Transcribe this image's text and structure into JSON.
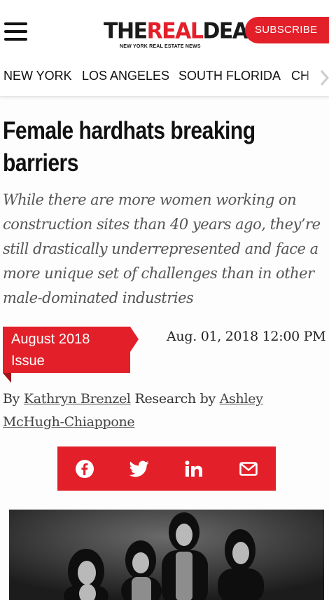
{
  "header": {
    "menu_icon": "hamburger-menu-icon",
    "logo": {
      "part1": "THE",
      "part2": "REAL",
      "part3": "DEAL",
      "tagline": "NEW YORK REAL ESTATE NEWS"
    },
    "subscribe_label": "SUBSCRIBE"
  },
  "nav": {
    "items": [
      "NEW YORK",
      "LOS ANGELES",
      "SOUTH FLORIDA",
      "CH"
    ],
    "more_icon": "chevron-right-icon"
  },
  "article": {
    "headline": "Female hardhats breaking barriers",
    "dek": "While there are more women working on construction sites than 40 years ago, they’re still drastically underrepresented and face a more unique set of challenges than in other male-dominated industries",
    "issue": "August 2018 Issue",
    "date": "Aug. 01, 2018 12:00 PM",
    "byline": {
      "by": "By",
      "author": "Kathryn Brenzel",
      "research_by": "Research by",
      "researcher": "Ashley McHugh-Chiappone"
    }
  },
  "share": {
    "icons": [
      "facebook-icon",
      "twitter-icon",
      "linkedin-icon",
      "email-icon"
    ]
  },
  "colors": {
    "accent": "#e3202a",
    "text": "#111111",
    "dek": "#555555"
  }
}
